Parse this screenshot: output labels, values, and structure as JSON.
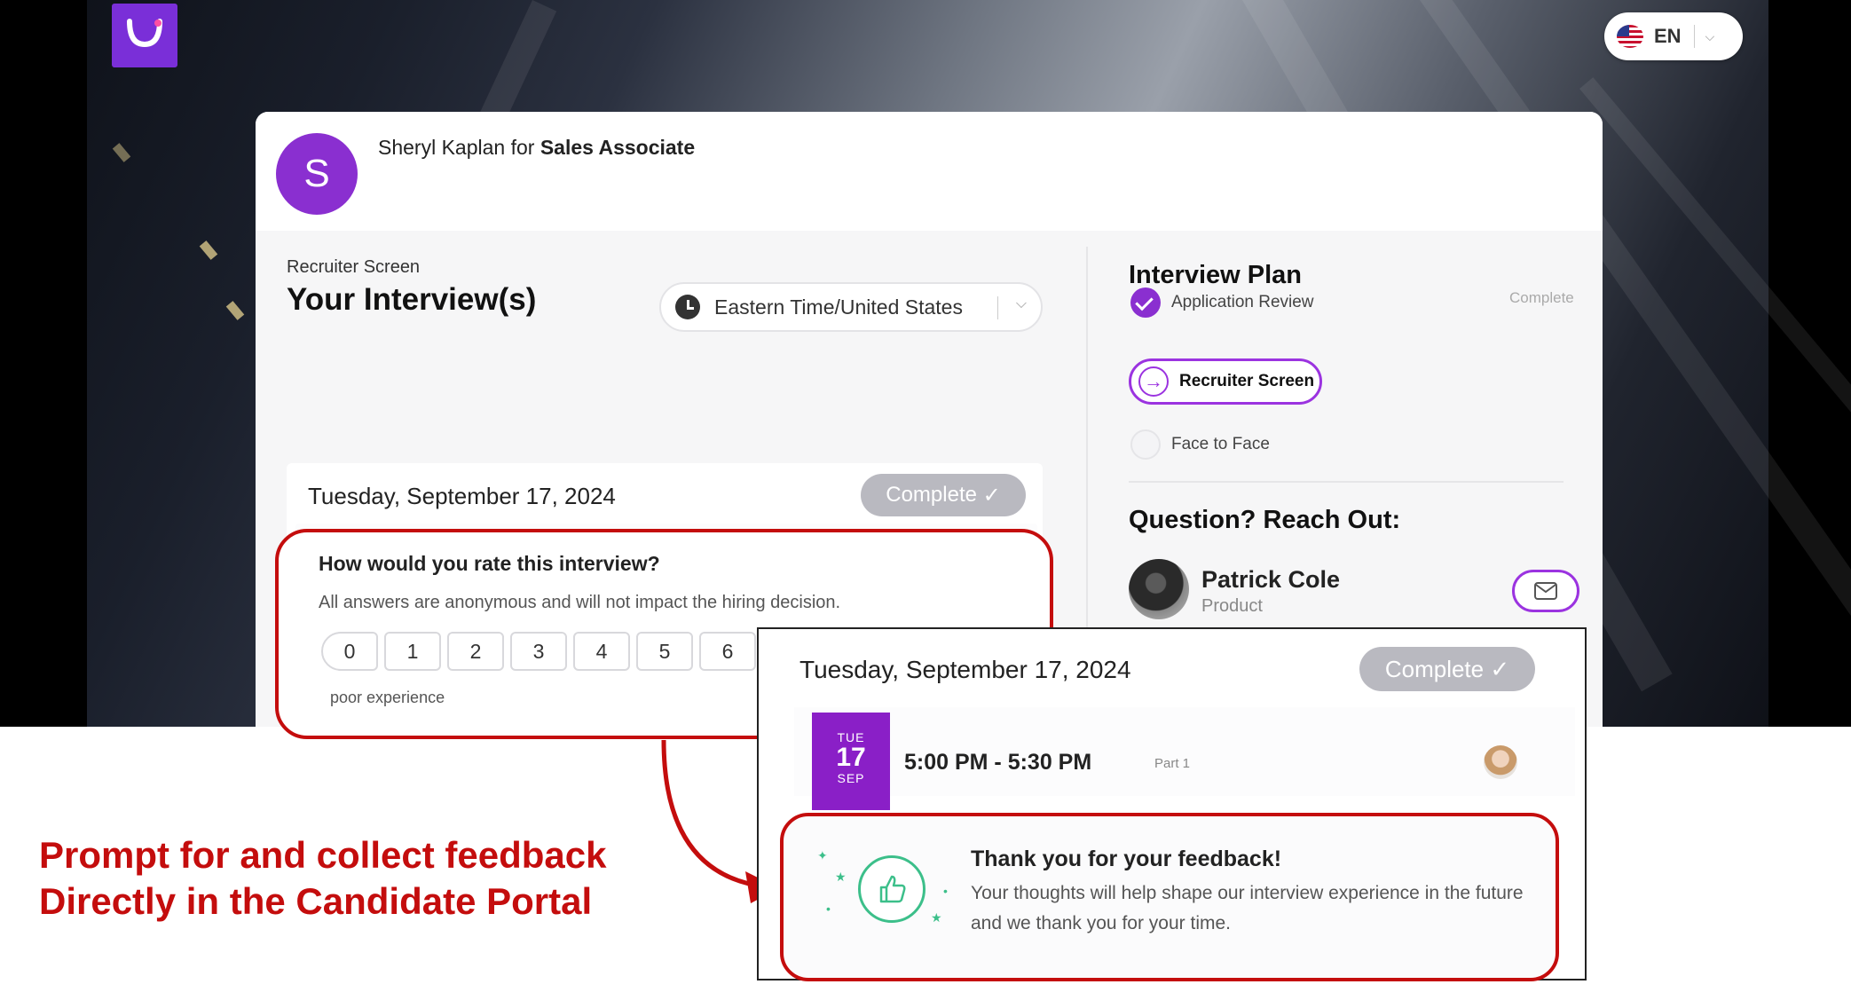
{
  "language": {
    "code": "EN",
    "flag": "us-flag-icon"
  },
  "candidate": {
    "initial": "S",
    "name": "Sheryl Kaplan",
    "for_text": "for",
    "position": "Sales Associate"
  },
  "interviews": {
    "step_label": "Recruiter Screen",
    "heading": "Your Interview(s)",
    "timezone": "Eastern Time/United States",
    "date_title": "Tuesday, September 17, 2024",
    "status": "Complete",
    "slot": {
      "dow": "TUE",
      "day": "17",
      "month": "SEP",
      "time": "5:00 PM - 5:30 PM",
      "part": "Part 1"
    }
  },
  "plan": {
    "title": "Interview Plan",
    "items": [
      {
        "label": "Application Review",
        "status": "Complete"
      },
      {
        "label": "Recruiter Screen",
        "status": ""
      },
      {
        "label": "Face to Face",
        "status": ""
      }
    ]
  },
  "contact": {
    "title": "Question? Reach Out:",
    "name": "Patrick Cole",
    "role": "Product"
  },
  "rating": {
    "question": "How would you rate this interview?",
    "subtext": "All answers are anonymous and will not impact the hiring decision.",
    "scale": [
      "0",
      "1",
      "2",
      "3",
      "4",
      "5",
      "6"
    ],
    "low_label": "poor experience"
  },
  "thanks": {
    "title": "Thank you for your feedback!",
    "body": "Your thoughts will help shape our interview experience in the future and we thank you for your time."
  },
  "caption": {
    "line1": "Prompt for and collect feedback",
    "line2": "Directly in the Candidate Portal"
  },
  "colors": {
    "brand_purple": "#8a2fd0",
    "callout_red": "#c40d0d",
    "feedback_green": "#3cbf8a",
    "status_gray": "#b9b9c0"
  }
}
